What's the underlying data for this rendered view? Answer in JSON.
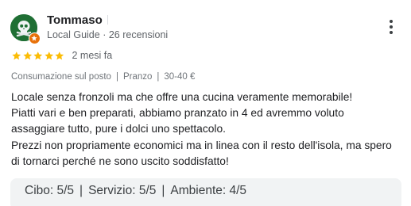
{
  "review": {
    "author": {
      "name": "Tommaso",
      "level": "Local Guide",
      "reviews_count": "26 recensioni",
      "separator": "·"
    },
    "rating": {
      "stars": 5,
      "max": 5,
      "date": "2 mesi fa"
    },
    "tags": [
      "Consumazione sul posto",
      "Pranzo",
      "30-40 €"
    ],
    "text_lines": [
      "Locale senza fronzoli ma che offre una cucina veramente memorabile!",
      "Piatti vari e ben preparati, abbiamo pranzato in 4 ed avremmo voluto",
      "assaggiare tutto, pure i dolci uno spettacolo.",
      "Prezzi non propriamente economici ma in linea con il resto dell'isola, ma spero",
      "di tornarci perché ne sono uscito soddisfatto!"
    ],
    "scores": [
      "Cibo: 5/5",
      "Servizio: 5/5",
      "Ambiente: 4/5"
    ]
  },
  "icons": {
    "avatar": "skull-avatar-icon",
    "badge": "local-guide-badge-icon",
    "more": "more-vertical-icon",
    "star": "star-icon"
  },
  "colors": {
    "star": "#fbbc04",
    "avatar_bg": "#1f6f34",
    "badge": "#e8710a",
    "secondary_text": "#5f6368",
    "score_panel_bg": "#f1f3f4"
  }
}
